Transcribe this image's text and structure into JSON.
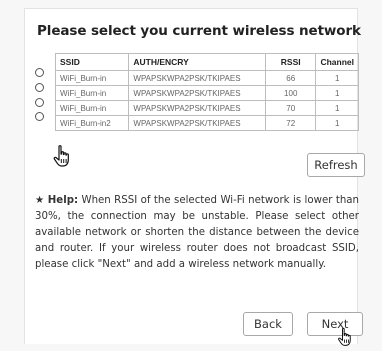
{
  "dialog": {
    "title": "Please select you current wireless network"
  },
  "table": {
    "headers": {
      "ssid": "SSID",
      "auth": "AUTH/ENCRY",
      "rssi": "RSSI",
      "channel": "Channel"
    },
    "rows": [
      {
        "ssid": "WiFi_Burn-in",
        "auth": "WPAPSKWPA2PSK/TKIPAES",
        "rssi": "66",
        "channel": "1"
      },
      {
        "ssid": "WiFi_Burn-in",
        "auth": "WPAPSKWPA2PSK/TKIPAES",
        "rssi": "100",
        "channel": "1"
      },
      {
        "ssid": "WiFi_Burn-in",
        "auth": "WPAPSKWPA2PSK/TKIPAES",
        "rssi": "70",
        "channel": "1"
      },
      {
        "ssid": "WiFi_Burn-in2",
        "auth": "WPAPSKWPA2PSK/TKIPAES",
        "rssi": "72",
        "channel": "1"
      }
    ]
  },
  "buttons": {
    "refresh": "Refresh",
    "back": "Back",
    "next": "Next"
  },
  "help": {
    "star": "★",
    "label": "Help:",
    "text": " When RSSI of the selected Wi-Fi network is lower than 30%, the connection may be unstable. Please select other available network or shorten the distance between the device and router. If your wireless router does not broadcast SSID, please click \"Next\" and add a wireless network manually."
  },
  "icons": {
    "radio": "radio-button-icon",
    "pointer": "hand-pointer-icon",
    "star": "star-icon"
  },
  "colors": {
    "border": "#bdbdbd",
    "text": "#333333",
    "cell_text": "#666666"
  }
}
